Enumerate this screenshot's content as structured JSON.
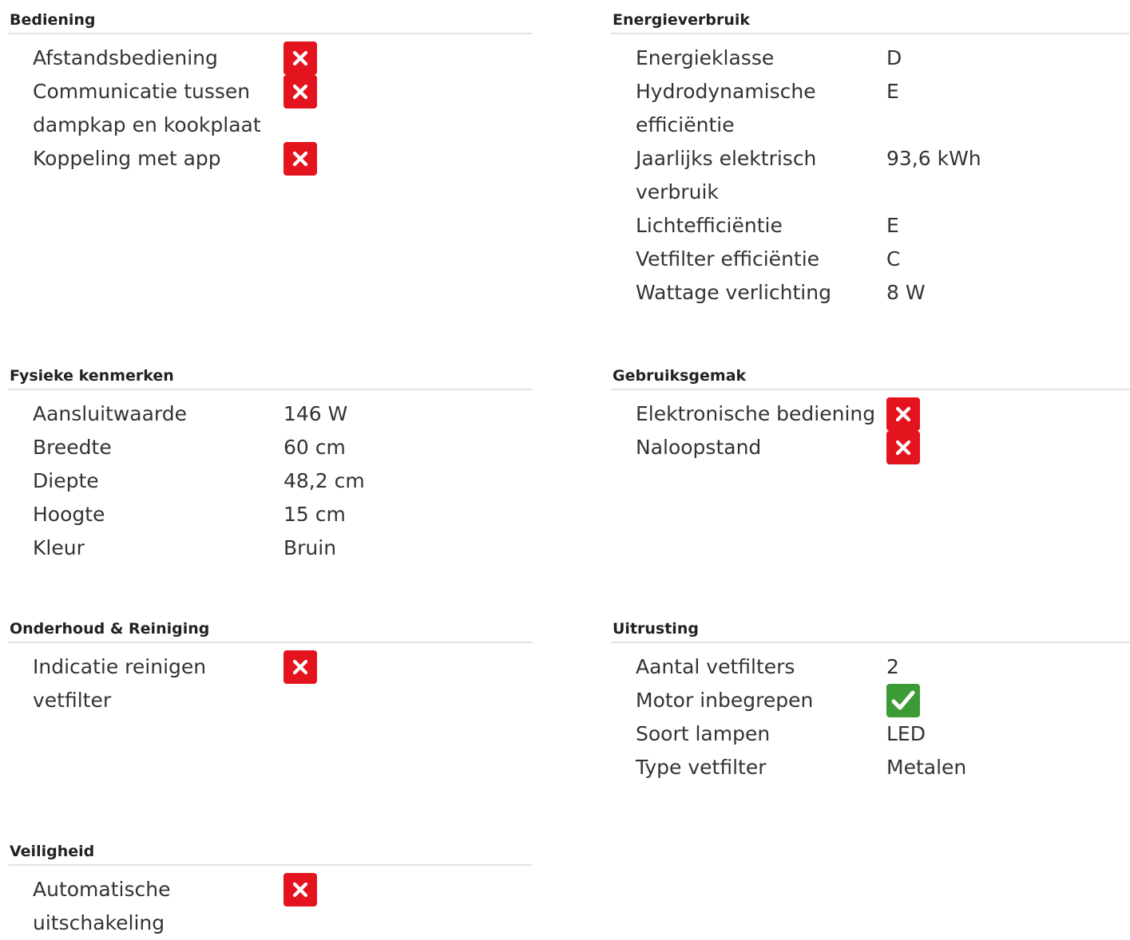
{
  "sections": [
    {
      "title": "Bediening",
      "rows": [
        {
          "label": "Afstandsbediening",
          "icon": "no"
        },
        {
          "label": "Communicatie tussen dampkap en kookplaat",
          "icon": "no"
        },
        {
          "label": "Koppeling met app",
          "icon": "no"
        }
      ]
    },
    {
      "title": "Energieverbruik",
      "rows": [
        {
          "label": "Energieklasse",
          "value": "D"
        },
        {
          "label": "Hydrodynamische efficiëntie",
          "value": "E"
        },
        {
          "label": "Jaarlijks elektrisch verbruik",
          "value": "93,6 kWh"
        },
        {
          "label": "Lichtefficiëntie",
          "value": "E"
        },
        {
          "label": "Vetfilter efficiëntie",
          "value": "C"
        },
        {
          "label": "Wattage verlichting",
          "value": "8 W"
        }
      ]
    },
    {
      "title": "Fysieke kenmerken",
      "rows": [
        {
          "label": "Aansluitwaarde",
          "value": "146 W"
        },
        {
          "label": "Breedte",
          "value": "60 cm"
        },
        {
          "label": "Diepte",
          "value": "48,2 cm"
        },
        {
          "label": "Hoogte",
          "value": "15 cm"
        },
        {
          "label": "Kleur",
          "value": "Bruin"
        }
      ]
    },
    {
      "title": "Gebruiksgemak",
      "rows": [
        {
          "label": "Elektronische bediening",
          "icon": "no"
        },
        {
          "label": "Naloopstand",
          "icon": "no"
        }
      ]
    },
    {
      "title": "Onderhoud & Reiniging",
      "rows": [
        {
          "label": "Indicatie reinigen vetfilter",
          "icon": "no"
        }
      ]
    },
    {
      "title": "Uitrusting",
      "rows": [
        {
          "label": "Aantal vetfilters",
          "value": "2"
        },
        {
          "label": "Motor inbegrepen",
          "icon": "yes"
        },
        {
          "label": "Soort lampen",
          "value": "LED"
        },
        {
          "label": "Type vetfilter",
          "value": "Metalen"
        }
      ]
    },
    {
      "title": "Veiligheid",
      "rows": [
        {
          "label": "Automatische uitschakeling",
          "icon": "no"
        }
      ]
    }
  ],
  "icons": {
    "no": {
      "name": "cross-icon",
      "color": "#e4141f"
    },
    "yes": {
      "name": "checkmark-icon",
      "color": "#3d9b35"
    }
  }
}
